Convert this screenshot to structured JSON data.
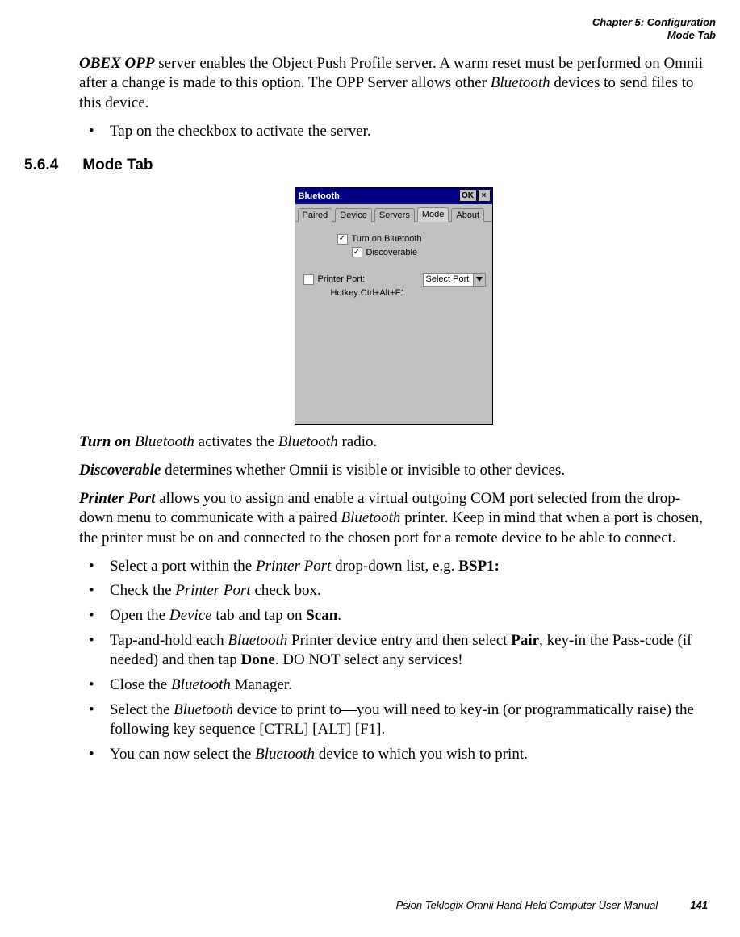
{
  "header": {
    "line1": "Chapter 5: Configuration",
    "line2": "Mode Tab"
  },
  "intro": {
    "obex_label": "OBEX OPP",
    "p1_part1": " server enables the Object Push Profile server. A warm reset must be performed on Omnii after a change is made to this option. The OPP Server allows other ",
    "bluetooth": "Bluetooth",
    "p1_part2": " devices to send files to this device.",
    "bullet1": "Tap on the checkbox to activate the server."
  },
  "section": {
    "num": "5.6.4",
    "title": "Mode Tab"
  },
  "win": {
    "title": "Bluetooth",
    "ok": "OK",
    "close": "×",
    "tabs": {
      "paired": "Paired",
      "device": "Device",
      "servers": "Servers",
      "mode": "Mode",
      "about": "About"
    },
    "chk_turn_on": "Turn on Bluetooth",
    "chk_discoverable": "Discoverable",
    "chk_printer_port": "Printer Port:",
    "dropdown_value": "Select Port",
    "hotkey": "Hotkey:Ctrl+Alt+F1",
    "checkmark": "✓"
  },
  "desc": {
    "turn_on_label": "Turn on",
    "turn_on_text_prefix": " ",
    "turn_on_text_mid": " activates the ",
    "turn_on_text_end": " radio.",
    "discoverable_label": "Discoverable",
    "discoverable_text": " determines whether Omnii is visible or invisible to other devices.",
    "printer_port_label": "Printer Port",
    "printer_port_text_1": " allows you to assign and enable a virtual outgoing COM port selected from the drop-down menu to communicate with a paired ",
    "printer_port_text_2": " printer. Keep in mind that when a port is chosen, the printer must be on and connected to the chosen port for a remote device to be able to connect."
  },
  "steps": {
    "s1_a": "Select a port within the ",
    "s1_b": "Printer Port",
    "s1_c": " drop-down list, e.g. ",
    "s1_d": "BSP1:",
    "s2_a": "Check the ",
    "s2_b": "Printer Port",
    "s2_c": " check box.",
    "s3_a": "Open the ",
    "s3_b": "Device",
    "s3_c": " tab and tap on ",
    "s3_d": "Scan",
    "s3_e": ".",
    "s4_a": "Tap-and-hold each ",
    "s4_b": "Bluetooth",
    "s4_c": " Printer device entry and then select ",
    "s4_d": "Pair",
    "s4_e": ", key-in the Pass-code (if needed) and then tap ",
    "s4_f": "Done",
    "s4_g": ". DO NOT select any services!",
    "s5_a": "Close the ",
    "s5_b": "Bluetooth",
    "s5_c": " Manager.",
    "s6_a": "Select the ",
    "s6_b": "Bluetooth",
    "s6_c": " device to print to—you will need to key-in (or programmatically raise) the following key sequence [CTRL] [ALT] [F1].",
    "s7_a": "You can now select the ",
    "s7_b": "Bluetooth",
    "s7_c": " device to which you wish to print."
  },
  "footer": {
    "text": "Psion Teklogix Omnii Hand-Held Computer User Manual",
    "page": "141"
  }
}
